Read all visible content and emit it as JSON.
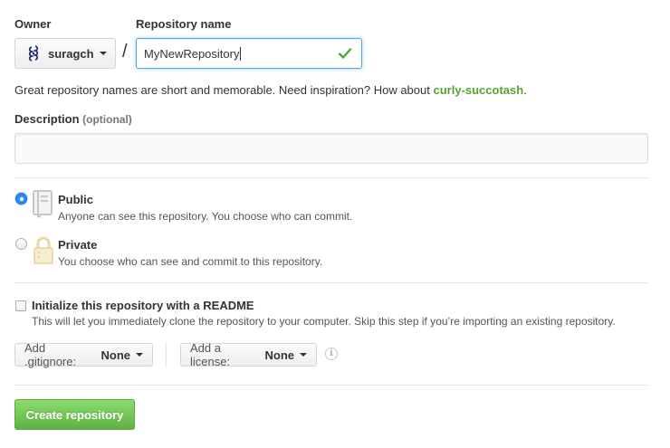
{
  "owner": {
    "label": "Owner",
    "value": "suragch"
  },
  "repository": {
    "label": "Repository name",
    "value": "MyNewRepository",
    "valid": true
  },
  "separator": "/",
  "hint": {
    "text": "Great repository names are short and memorable. Need inspiration? How about",
    "suggestion": "curly-succotash",
    "end": "."
  },
  "description": {
    "label": "Description",
    "optional": "(optional)",
    "value": ""
  },
  "visibility": {
    "selected": "public",
    "options": [
      {
        "id": "public",
        "title": "Public",
        "note": "Anyone can see this repository. You choose who can commit."
      },
      {
        "id": "private",
        "title": "Private",
        "note": "You choose who can see and commit to this repository."
      }
    ]
  },
  "readme": {
    "checked": false,
    "label": "Initialize this repository with a README",
    "note": "This will let you immediately clone the repository to your computer. Skip this step if you’re importing an existing repository."
  },
  "gitignore": {
    "prefix": "Add .gitignore:",
    "value": "None"
  },
  "license": {
    "prefix": "Add a license:",
    "value": "None"
  },
  "info_icon": "info-icon",
  "submit": {
    "label": "Create repository"
  },
  "colors": {
    "accent": "#2e8ef0",
    "success": "#55a532",
    "primary_button": "#60b044",
    "focus_border": "#51a7e8"
  }
}
